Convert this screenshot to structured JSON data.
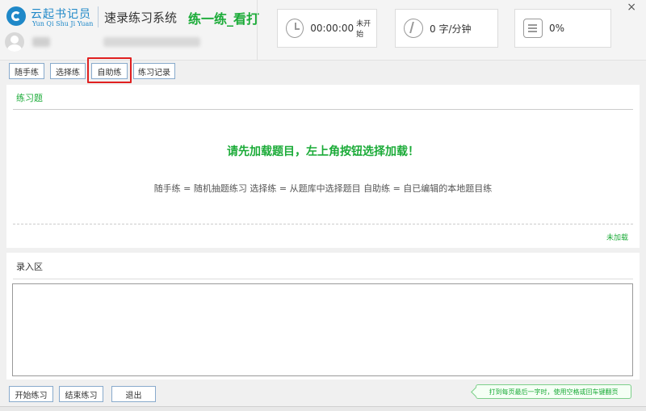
{
  "header": {
    "brand_cn": "云起书记员",
    "brand_en": "Yun Qi Shu Ji Yuan",
    "system_title": "速录练习系统",
    "mode_title": "练一练_看打",
    "close_glyph": "×"
  },
  "stats": {
    "timer_value": "00:00:00",
    "timer_status": "未开始",
    "speed_value": "0 字/分钟",
    "accuracy_value": "0%"
  },
  "tabs": [
    {
      "label": "随手练"
    },
    {
      "label": "选择练"
    },
    {
      "label": "自助练"
    },
    {
      "label": "练习记录"
    }
  ],
  "exercise": {
    "title": "练习题",
    "prompt": "请先加载题目，左上角按钮选择加载！",
    "description": "随手练 = 随机抽题练习 选择练 = 从题库中选择题目 自助练 = 自已编辑的本地题目练",
    "status": "未加载"
  },
  "input_area": {
    "title": "录入区",
    "value": ""
  },
  "bottom": {
    "start_label": "开始练习",
    "end_label": "结束练习",
    "exit_label": "退出",
    "hint": "打到每页最后一字时，使用空格或回车键翻页"
  },
  "colors": {
    "brand_blue": "#1f88c8",
    "accent_green": "#1bab38",
    "highlight_red": "#e02020"
  },
  "icons": [
    "clock-icon",
    "speed-icon",
    "accuracy-icon",
    "close-icon",
    "avatar-icon"
  ]
}
